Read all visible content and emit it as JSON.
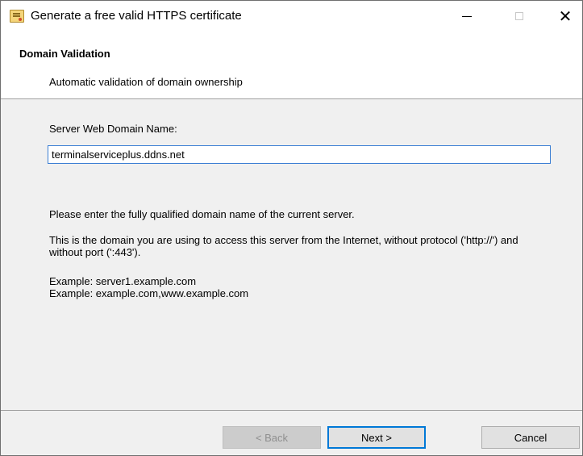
{
  "window": {
    "title": "Generate a free valid HTTPS certificate",
    "icon": "certificate-icon",
    "controls": {
      "minimize": "minimize-icon",
      "maximize": "maximize-icon",
      "close_glyph": "✕"
    }
  },
  "header": {
    "title": "Domain Validation",
    "subtitle": "Automatic validation of domain ownership"
  },
  "form": {
    "domain_label": "Server Web Domain Name:",
    "domain_value": "terminalserviceplus.ddns.net"
  },
  "help": {
    "line1": "Please enter the fully qualified domain name of the current server.",
    "line2": "This is the domain you are using to access this server from the Internet, without protocol ('http://') and without port (':443').",
    "example1": "Example: server1.example.com",
    "example2": "Example: example.com,www.example.com"
  },
  "buttons": {
    "back": "< Back",
    "next": "Next >",
    "cancel": "Cancel"
  },
  "colors": {
    "focus_border": "#0078d7",
    "input_border": "#3c7fd4",
    "dialog_bg": "#f0f0f0",
    "header_bg": "#ffffff"
  }
}
